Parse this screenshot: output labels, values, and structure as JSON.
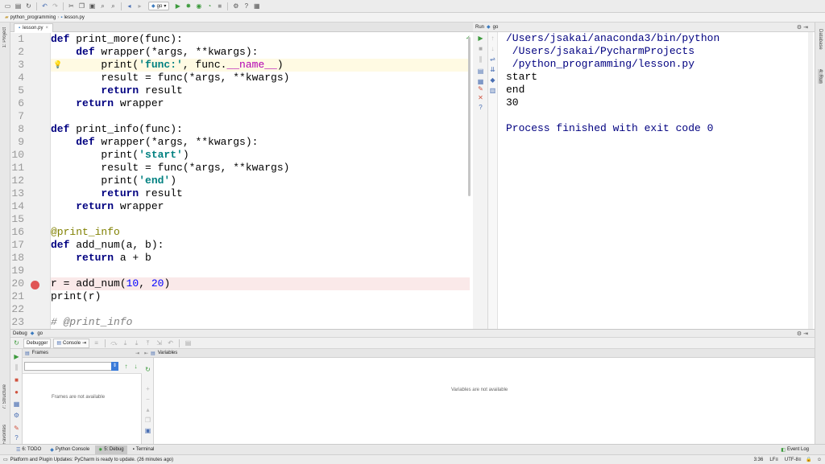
{
  "toolbar": {
    "run_config": "go",
    "icons": [
      "folder-icon",
      "save-icon",
      "sync-icon",
      "undo-icon",
      "redo-icon",
      "cut-icon",
      "copy-icon",
      "paste-icon",
      "find-icon",
      "replace-icon",
      "back-icon",
      "forward-icon",
      "run-icon",
      "debug-icon",
      "coverage-icon",
      "profile-icon",
      "stop-icon",
      "vcs-icon",
      "help-icon"
    ]
  },
  "navbar": {
    "breadcrumbs": [
      "python_programming",
      "lesson.py"
    ]
  },
  "left_stripe": {
    "project": "1: Project",
    "structure": "7: Structure",
    "favorites": "2: Favorites"
  },
  "right_stripe": {
    "database": "Database",
    "run": "4: Run"
  },
  "editor": {
    "tab_label": "lesson.py",
    "line_numbers": [
      "1",
      "2",
      "3",
      "4",
      "5",
      "6",
      "7",
      "8",
      "9",
      "10",
      "11",
      "12",
      "13",
      "14",
      "15",
      "16",
      "17",
      "18",
      "19",
      "20",
      "21",
      "22",
      "23"
    ]
  },
  "run_panel": {
    "header_label": "Run",
    "config": "go",
    "output": [
      "/Users/jsakai/anaconda3/bin/python",
      " /Users/jsakai/PycharmProjects",
      " /python_programming/lesson.py",
      "start",
      "end",
      "30",
      "",
      "Process finished with exit code 0"
    ]
  },
  "debug_panel": {
    "header_label": "Debug",
    "config": "go",
    "tab_debugger": "Debugger",
    "tab_console": "Console",
    "frames_title": "Frames",
    "frames_empty": "Frames are not available",
    "variables_title": "Variables",
    "variables_empty": "Variables are not available"
  },
  "bottom_tabs": {
    "todo": "6: TODO",
    "python_console": "Python Console",
    "debug": "5: Debug",
    "terminal": "Terminal",
    "event_log": "Event Log"
  },
  "status_bar": {
    "message": "Platform and Plugin Updates: PyCharm is ready to update. (26 minutes ago)",
    "position": "3:36",
    "line_sep": "LF≡",
    "encoding": "UTF-8≡"
  },
  "colors": {
    "keyword": "#000080",
    "string": "#008080",
    "number": "#0000ff",
    "decorator": "#808000",
    "breakpoint": "#e05555",
    "breakpoint_line": "#fae9e9",
    "current_line": "#fffae3",
    "output_text": "#000080"
  }
}
